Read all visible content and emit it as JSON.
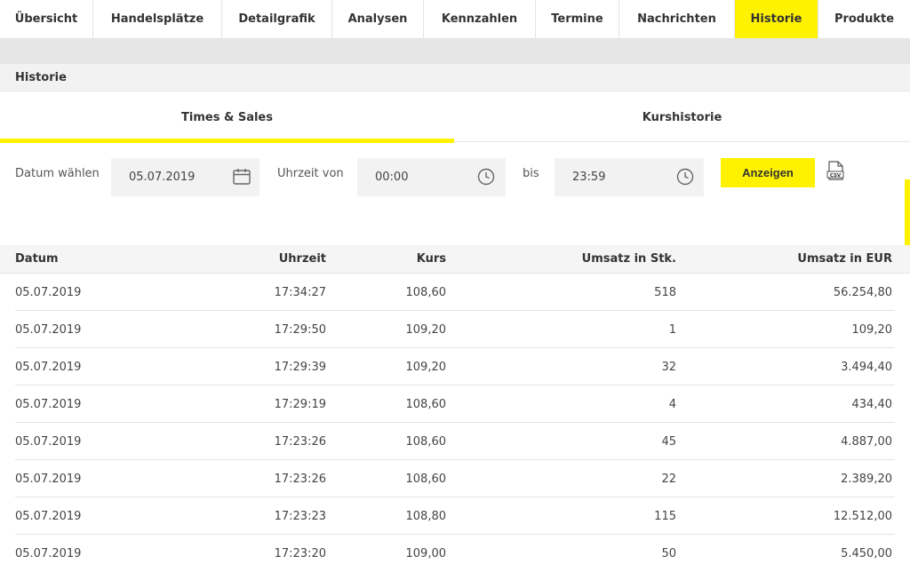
{
  "topnav": {
    "tabs": [
      {
        "label": "Übersicht",
        "active": false
      },
      {
        "label": "Handelsplätze",
        "active": false
      },
      {
        "label": "Detailgrafik",
        "active": false
      },
      {
        "label": "Analysen",
        "active": false
      },
      {
        "label": "Kennzahlen",
        "active": false
      },
      {
        "label": "Termine",
        "active": false
      },
      {
        "label": "Nachrichten",
        "active": false
      },
      {
        "label": "Historie",
        "active": true
      },
      {
        "label": "Produkte",
        "active": false
      }
    ]
  },
  "section": {
    "title": "Historie"
  },
  "subtabs": [
    {
      "label": "Times & Sales",
      "active": true
    },
    {
      "label": "Kurshistorie",
      "active": false
    }
  ],
  "filters": {
    "date_label": "Datum wählen",
    "date_value": "05.07.2019",
    "time_from_label": "Uhrzeit von",
    "time_from_value": "00:00",
    "to_label": "bis",
    "time_to_value": "23:59",
    "show_button": "Anzeigen",
    "csv_icon": "csv-download-icon"
  },
  "table": {
    "headers": {
      "date": "Datum",
      "time": "Uhrzeit",
      "price": "Kurs",
      "volume_pcs": "Umsatz in Stk.",
      "volume_eur": "Umsatz in EUR"
    },
    "rows": [
      {
        "date": "05.07.2019",
        "time": "17:34:27",
        "price": "108,60",
        "volume_pcs": "518",
        "volume_eur": "56.254,80"
      },
      {
        "date": "05.07.2019",
        "time": "17:29:50",
        "price": "109,20",
        "volume_pcs": "1",
        "volume_eur": "109,20"
      },
      {
        "date": "05.07.2019",
        "time": "17:29:39",
        "price": "109,20",
        "volume_pcs": "32",
        "volume_eur": "3.494,40"
      },
      {
        "date": "05.07.2019",
        "time": "17:29:19",
        "price": "108,60",
        "volume_pcs": "4",
        "volume_eur": "434,40"
      },
      {
        "date": "05.07.2019",
        "time": "17:23:26",
        "price": "108,60",
        "volume_pcs": "45",
        "volume_eur": "4.887,00"
      },
      {
        "date": "05.07.2019",
        "time": "17:23:26",
        "price": "108,60",
        "volume_pcs": "22",
        "volume_eur": "2.389,20"
      },
      {
        "date": "05.07.2019",
        "time": "17:23:23",
        "price": "108,80",
        "volume_pcs": "115",
        "volume_eur": "12.512,00"
      },
      {
        "date": "05.07.2019",
        "time": "17:23:20",
        "price": "109,00",
        "volume_pcs": "50",
        "volume_eur": "5.450,00"
      }
    ]
  },
  "colors": {
    "accent": "#fff200",
    "header_bg": "#f2f2f2",
    "text": "#333333"
  }
}
